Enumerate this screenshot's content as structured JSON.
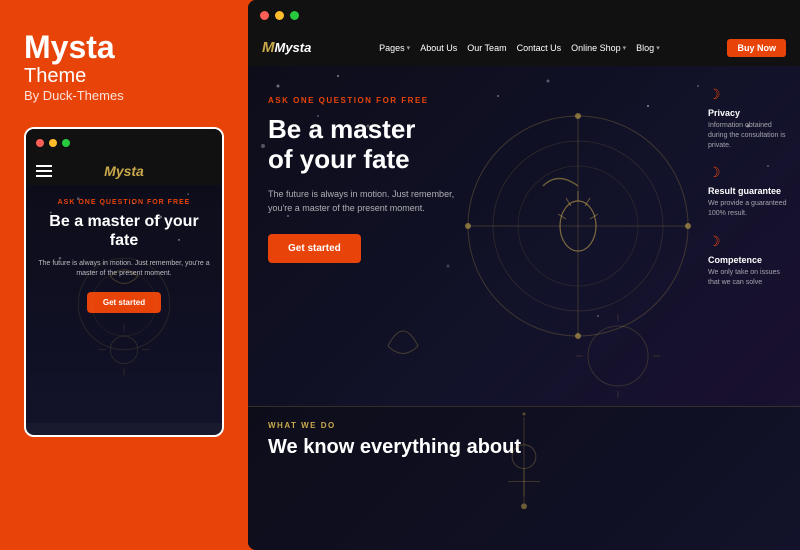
{
  "brand": {
    "name": "Mysta",
    "subtitle": "Theme",
    "by": "By Duck-Themes"
  },
  "mobile": {
    "logo": "Mysta",
    "ask_label": "ASK ONE QUESTION FOR FREE",
    "hero_title": "Be a master of your fate",
    "hero_desc": "The future is always in motion. Just remember, you're a master of the present moment.",
    "cta": "Get started"
  },
  "desktop": {
    "logo": "Mysta",
    "nav": {
      "items": [
        {
          "label": "Pages",
          "has_dropdown": true
        },
        {
          "label": "About Us",
          "has_dropdown": false
        },
        {
          "label": "Our Team",
          "has_dropdown": false
        },
        {
          "label": "Contact Us",
          "has_dropdown": false
        },
        {
          "label": "Online Shop",
          "has_dropdown": true
        },
        {
          "label": "Blog",
          "has_dropdown": true
        }
      ],
      "cta": "Buy Now"
    },
    "hero": {
      "ask_label": "ASK ONE QUESTION FOR FREE",
      "title_line1": "Be a master",
      "title_line2": "of your fate",
      "description": "The future is always in motion. Just remember, you're a master of the present moment.",
      "cta": "Get started"
    },
    "features": [
      {
        "title": "Privacy",
        "desc": "Information obtained during the consultation is private."
      },
      {
        "title": "Result guarantee",
        "desc": "We provide a guaranteed 100% result."
      },
      {
        "title": "Competence",
        "desc": "We only take on issues that we can solve"
      }
    ],
    "bottom": {
      "label": "WHAT WE DO",
      "title_line1": "We know everything about"
    }
  },
  "colors": {
    "accent": "#e8440a",
    "gold": "#c8a84b",
    "dark_bg": "#0d0d1a",
    "white": "#ffffff"
  },
  "dots": {
    "red": "#ff5f56",
    "yellow": "#ffbd2e",
    "green": "#27c93f"
  }
}
